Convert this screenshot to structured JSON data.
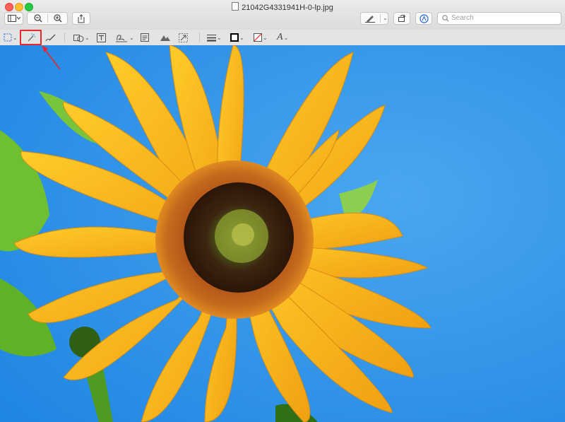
{
  "window": {
    "title": "21042G4331941H-0-lp.jpg"
  },
  "toolbar": {
    "sidebar_button": "sidebar-icon",
    "zoom_out_button": "zoom-out-icon",
    "zoom_in_button": "zoom-in-icon",
    "share_button": "share-icon",
    "markup_pen_button": "pen-icon",
    "rotate_button": "rotate-icon",
    "annotate_button": "markup-icon"
  },
  "search": {
    "placeholder": "Search"
  },
  "markup_tools": [
    "rectangular-selection-icon",
    "instant-alpha-icon",
    "sketch-icon",
    "shapes-icon",
    "text-icon",
    "sign-icon",
    "note-icon",
    "adjust-color-icon",
    "adjust-size-icon",
    "shape-style-icon",
    "border-color-icon",
    "fill-color-icon",
    "text-style-icon"
  ],
  "colors": {
    "highlight": "#e8262c",
    "sky": "#2f93ea",
    "petal": "#f5b51a",
    "center": "#8a3a12"
  },
  "image": {
    "subject": "sunflower"
  }
}
